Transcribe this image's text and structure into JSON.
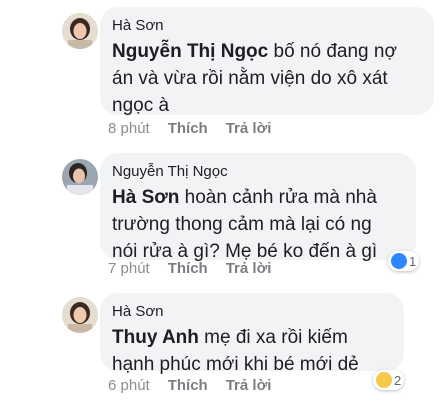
{
  "comments": [
    {
      "author": "Hà Sơn",
      "mention": "Nguyễn Thị Ngọc",
      "text": " bố nó đang nợ án và vừa rồi nằm viện do xô xát ngọc à",
      "time": "8 phút",
      "like_label": "Thích",
      "reply_label": "Trả lời"
    },
    {
      "author": "Nguyễn Thị Ngọc",
      "mention": "Hà Sơn",
      "text": " hoàn cảnh rửa mà nhà trường thong cảm mà lại có ng nói rửa à gì? Mẹ bé ko đến à gì",
      "time": "7 phút",
      "like_label": "Thích",
      "reply_label": "Trả lời",
      "reaction": {
        "icon": "like-icon",
        "count": "1",
        "color": "#2d88ff"
      }
    },
    {
      "author": "Hà Sơn",
      "mention": "Thuy Anh",
      "text": " mẹ đi xa rồi kiếm hạnh phúc mới khi bé mới dẻ",
      "time": "6 phút",
      "like_label": "Thích",
      "reply_label": "Trả lời",
      "reaction": {
        "icon": "sad-icon",
        "count": "2",
        "color": "#f7c94a"
      }
    }
  ]
}
